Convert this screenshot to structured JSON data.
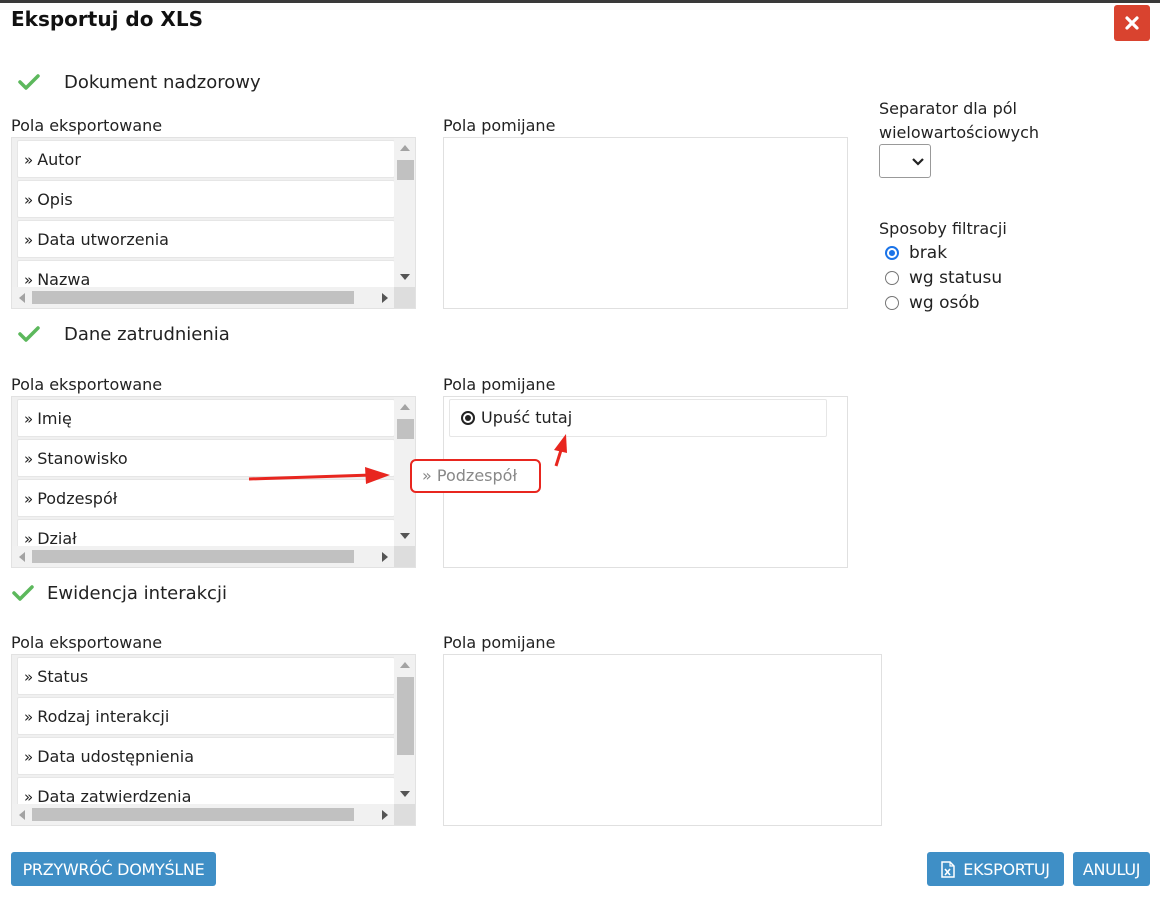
{
  "dialog": {
    "title": "Eksportuj do XLS"
  },
  "labels": {
    "exported": "Pola eksportowane",
    "skipped": "Pola pomijane"
  },
  "sections": [
    {
      "title": "Dokument nadzorowy",
      "exported_fields": [
        "Autor",
        "Opis",
        "Data utworzenia",
        "Nazwa"
      ],
      "skipped_fields": []
    },
    {
      "title": "Dane zatrudnienia",
      "exported_fields": [
        "Imię",
        "Stanowisko",
        "Podzespół",
        "Dział"
      ],
      "skipped_fields": [],
      "drop_placeholder": "Upuść tutaj",
      "dragged_item": "Podzespół"
    },
    {
      "title": "Ewidencja interakcji",
      "exported_fields": [
        "Status",
        "Rodzaj interakcji",
        "Data udostępnienia",
        "Data zatwierdzenia"
      ],
      "skipped_fields": []
    }
  ],
  "options": {
    "separator_label": "Separator dla pól wielowartościowych",
    "separator_value": "",
    "filter_label": "Sposoby filtracji",
    "filters": [
      {
        "label": "brak",
        "checked": true
      },
      {
        "label": "wg statusu",
        "checked": false
      },
      {
        "label": "wg osób",
        "checked": false
      }
    ]
  },
  "buttons": {
    "restore_defaults": "PRZYWRÓĆ DOMYŚLNE",
    "export": "EKSPORTUJ",
    "cancel": "ANULUJ"
  },
  "colors": {
    "primary_button": "#3f8fc6",
    "close_button": "#d9432f",
    "check_icon": "#5cb85c",
    "annotation": "#e8261f"
  }
}
